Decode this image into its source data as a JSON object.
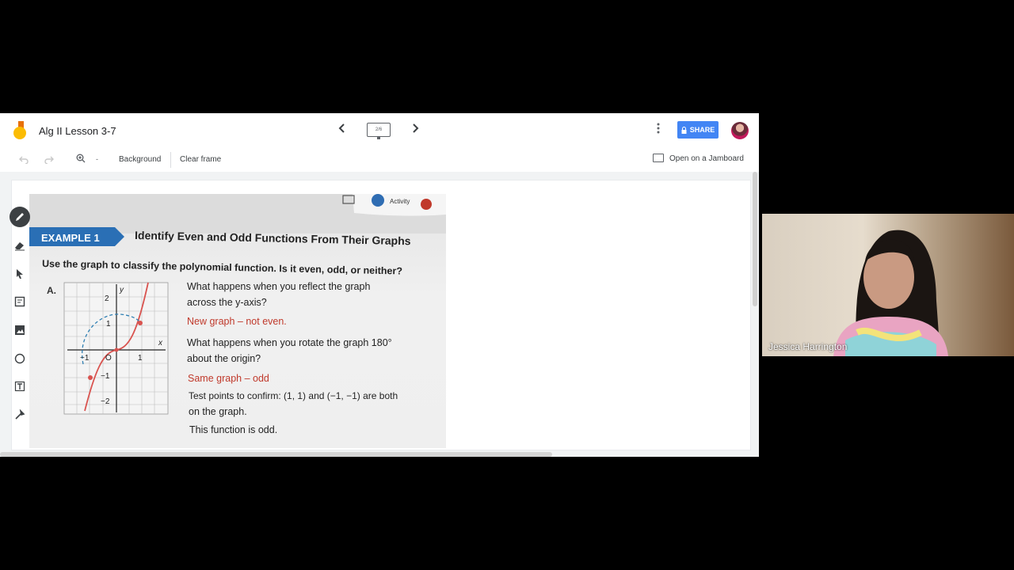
{
  "header": {
    "doc_title": "Alg II Lesson 3-7",
    "frame_indicator": "2/6",
    "share_label": "SHARE",
    "more_icon": "more-vert-icon"
  },
  "toolbar": {
    "zoom_dropdown": "-",
    "background_label": "Background",
    "clear_label": "Clear frame",
    "open_label": "Open on a Jamboard"
  },
  "side_tools": [
    "pen-icon",
    "eraser-icon",
    "select-icon",
    "sticky-note-icon",
    "image-icon",
    "circle-icon",
    "text-box-icon",
    "laser-icon"
  ],
  "photo": {
    "badge_activity": "Activity",
    "example_label": "EXAMPLE 1",
    "heading": "Identify Even and Odd Functions From Their Graphs",
    "prompt": "Use the graph to classify the polynomial function. Is it even, odd, or neither?",
    "part_label": "A.",
    "q1_line1": "What happens when you reflect the graph",
    "q1_line2": "across the y-axis?",
    "a1": "New graph – not even.",
    "q2_line1": "What happens when you rotate the graph 180°",
    "q2_line2": "about the origin?",
    "a2": "Same graph – odd",
    "test_line1": "Test points to confirm: (1, 1) and (−1, −1) are both",
    "test_line2": "on the graph.",
    "conclusion": "This function is odd.",
    "graph": {
      "y_axis": "y",
      "x_axis": "x",
      "origin": "O",
      "y2": "2",
      "y1": "1",
      "yneg1": "−1",
      "yneg2": "−2",
      "xneg1": "−1",
      "x1": "1"
    }
  },
  "video": {
    "participant_name": "Jessica Harrington"
  },
  "colors": {
    "accent": "#4285f4",
    "example_banner": "#2a6fb5",
    "answer_red": "#c0392b"
  }
}
